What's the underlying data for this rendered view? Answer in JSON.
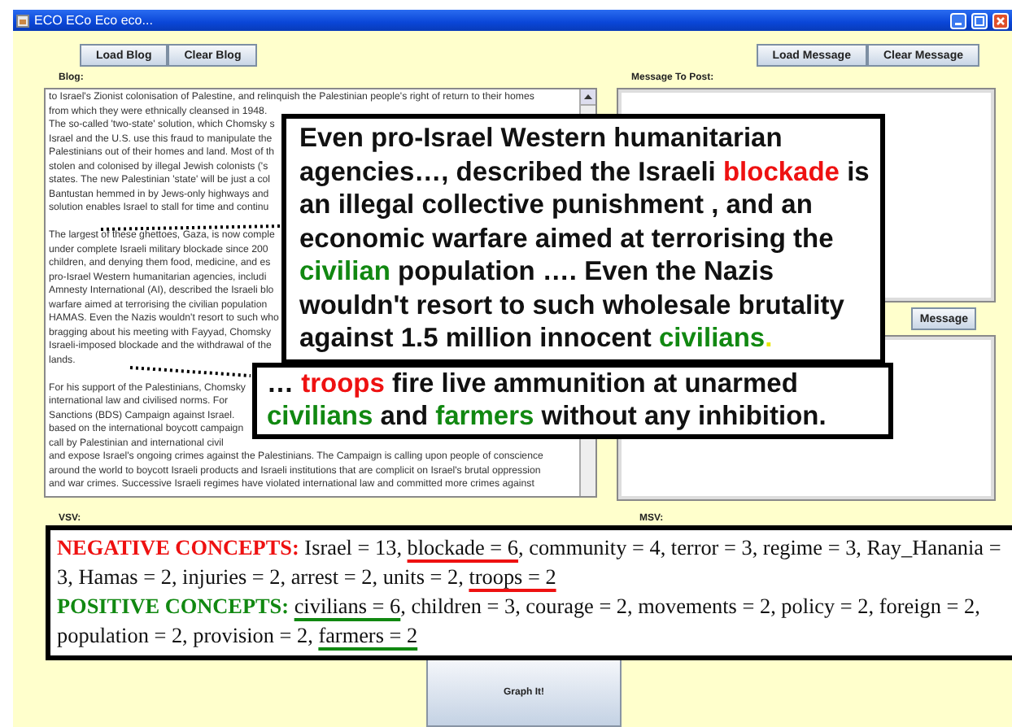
{
  "window": {
    "title": "ECO ECo Eco eco..."
  },
  "blog_buttons": [
    "Load Blog",
    "Clear Blog"
  ],
  "message_buttons": [
    "Load Message",
    "Clear Message"
  ],
  "blog": {
    "label": "Blog:",
    "paragraphs": [
      [
        "to Israel's Zionist colonisation of Palestine, and relinquish the Palestinian people's right of return to their homes",
        "from which they were ethnically cleansed in 1948.",
        "The so-called 'two-state' solution, which Chomsky s",
        "Israel and the U.S. use this fraud to manipulate the",
        "Palestinians out of their homes and land. Most of th",
        "stolen and colonised by illegal Jewish colonists ('s",
        "states. The new Palestinian 'state' will be just a col",
        "Bantustan hemmed in by Jews-only highways and",
        "solution enables Israel to stall for time and continu"
      ],
      [
        "The largest of these ghettoes, Gaza, is now comple",
        "under complete Israeli military blockade since 200",
        "children, and denying them food, medicine, and es",
        "pro-Israel Western humanitarian agencies, includi",
        "Amnesty International (AI), described the Israeli blo",
        "warfare aimed at terrorising the civilian population",
        "HAMAS. Even the Nazis wouldn't resort to such who",
        "bragging about his meeting with Fayyad, Chomsky",
        "Israeli-imposed blockade and the withdrawal of the",
        "lands."
      ],
      [
        "For his support of the Palestinians, Chomsky",
        "international law and civilised norms. For",
        "Sanctions (BDS) Campaign against Israel.",
        "based on the international boycott campaign",
        "call by Palestinian and international civil",
        "and expose Israel's ongoing crimes against the Palestinians. The Campaign is calling upon people of conscience",
        "around the world to boycott Israeli products and Israeli institutions that are complicit on Israel's brutal oppression",
        "and war crimes. Successive Israeli regimes have violated international law and committed more crimes against"
      ]
    ]
  },
  "message": {
    "label": "Message To Post:",
    "button_partial": "Message"
  },
  "vsv_label": "VSV:",
  "msv_label": "MSV:",
  "callouts": [
    {
      "segments": [
        {
          "text": "Even pro-Israel Western humanitarian agencies…, described the Israeli ",
          "color": "#111111"
        },
        {
          "text": "blockade",
          "color": "#ee1111"
        },
        {
          "text": " is an illegal collective punishment , and an economic warfare aimed at terrorising the ",
          "color": "#111111"
        },
        {
          "text": "civilian",
          "color": "#118811"
        },
        {
          "text": " population …. Even the Nazis wouldn't resort to such wholesale brutality against 1.5 million innocent ",
          "color": "#111111"
        },
        {
          "text": "civilians",
          "color": "#118811"
        },
        {
          "text": ".",
          "color": "#e8e800"
        }
      ]
    },
    {
      "segments": [
        {
          "text": "… ",
          "color": "#111111"
        },
        {
          "text": "troops",
          "color": "#ee1111"
        },
        {
          "text": " fire live ammunition at unarmed ",
          "color": "#111111"
        },
        {
          "text": "civilians",
          "color": "#118811"
        },
        {
          "text": " and ",
          "color": "#111111"
        },
        {
          "text": "farmers",
          "color": "#118811"
        },
        {
          "text": " without any inhibition.",
          "color": "#111111"
        }
      ]
    }
  ],
  "concepts": [
    {
      "heading": "NEGATIVE CONCEPTS:",
      "color": "#ee1111",
      "items": [
        {
          "text": "Israel = 13",
          "underlined": false
        },
        {
          "text": "blockade = 6",
          "underlined": true
        },
        {
          "text": "community = 4",
          "underlined": false
        },
        {
          "text": "terror = 3",
          "underlined": false
        },
        {
          "text": "regime = 3",
          "underlined": false
        },
        {
          "text": "Ray_Hanania = 3",
          "underlined": false
        },
        {
          "text": "Hamas = 2",
          "underlined": false
        },
        {
          "text": "injuries = 2",
          "underlined": false
        },
        {
          "text": "arrest = 2",
          "underlined": false
        },
        {
          "text": "units = 2",
          "underlined": false
        },
        {
          "text": "troops = 2",
          "underlined": true
        }
      ]
    },
    {
      "heading": "POSITIVE CONCEPTS:",
      "color": "#118811",
      "items": [
        {
          "text": "civilians = 6",
          "underlined": true
        },
        {
          "text": "children = 3",
          "underlined": false
        },
        {
          "text": "courage = 2",
          "underlined": false
        },
        {
          "text": "movements = 2",
          "underlined": false
        },
        {
          "text": "policy = 2",
          "underlined": false
        },
        {
          "text": "foreign = 2",
          "underlined": false
        },
        {
          "text": "population = 2",
          "underlined": false
        },
        {
          "text": "provision = 2",
          "underlined": false
        },
        {
          "text": "farmers = 2",
          "underlined": true
        }
      ]
    }
  ],
  "separator": ", ",
  "graph_button": "Graph It!"
}
